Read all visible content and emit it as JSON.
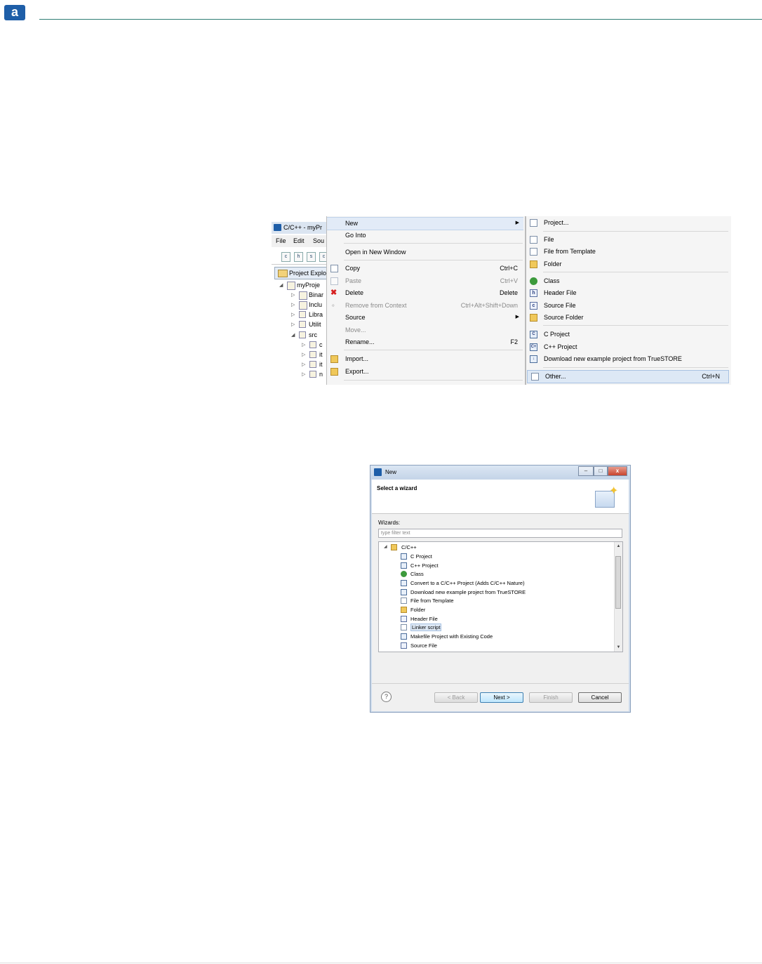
{
  "doc": {
    "logo_letter": "a"
  },
  "ide": {
    "title": "C/C++ - myPr",
    "menus": [
      "File",
      "Edit",
      "Sou"
    ],
    "toolbar": [
      "c",
      "h",
      "s",
      "c"
    ],
    "explorer_tab": "Project Explo",
    "tree": [
      {
        "arrow": "◢",
        "label": "myProje",
        "indent": 0
      },
      {
        "arrow": "▷",
        "label": "Binar",
        "indent": 1
      },
      {
        "arrow": "▷",
        "label": "Inclu",
        "indent": 1
      },
      {
        "arrow": "▷",
        "label": "Libra",
        "indent": 1
      },
      {
        "arrow": "▷",
        "label": "Utilit",
        "indent": 1
      },
      {
        "arrow": "◢",
        "label": "src",
        "indent": 1
      },
      {
        "arrow": "▷",
        "label": "c",
        "indent": 2
      },
      {
        "arrow": "▷",
        "label": "it",
        "indent": 2
      },
      {
        "arrow": "▷",
        "label": "it",
        "indent": 2
      },
      {
        "arrow": "▷",
        "label": "n",
        "indent": 2
      }
    ]
  },
  "context_menu": {
    "items": [
      {
        "label": "New",
        "shortcut": "",
        "submenu": true,
        "disabled": false,
        "highlight": true,
        "icon": ""
      },
      {
        "label": "Go Into",
        "shortcut": "",
        "submenu": false,
        "disabled": false,
        "icon": ""
      },
      {
        "label": "Open in New Window",
        "shortcut": "",
        "submenu": false,
        "disabled": false,
        "icon": ""
      },
      {
        "label": "Copy",
        "shortcut": "Ctrl+C",
        "submenu": false,
        "disabled": false,
        "icon": "copy-icon"
      },
      {
        "label": "Paste",
        "shortcut": "Ctrl+V",
        "submenu": false,
        "disabled": true,
        "icon": "paste-icon"
      },
      {
        "label": "Delete",
        "shortcut": "Delete",
        "submenu": false,
        "disabled": false,
        "icon": "delete-icon"
      },
      {
        "label": "Remove from Context",
        "shortcut": "Ctrl+Alt+Shift+Down",
        "submenu": false,
        "disabled": true,
        "icon": "remove-context-icon"
      },
      {
        "label": "Source",
        "shortcut": "",
        "submenu": true,
        "disabled": false,
        "icon": ""
      },
      {
        "label": "Move...",
        "shortcut": "",
        "submenu": false,
        "disabled": true,
        "icon": ""
      },
      {
        "label": "Rename...",
        "shortcut": "F2",
        "submenu": false,
        "disabled": false,
        "icon": ""
      },
      {
        "label": "Import...",
        "shortcut": "",
        "submenu": false,
        "disabled": false,
        "icon": "import-icon"
      },
      {
        "label": "Export...",
        "shortcut": "",
        "submenu": false,
        "disabled": false,
        "icon": "export-icon"
      }
    ]
  },
  "new_submenu": {
    "items": [
      {
        "label": "Project...",
        "shortcut": "",
        "icon": "project-icon"
      },
      {
        "label": "File",
        "shortcut": "",
        "icon": "file-icon"
      },
      {
        "label": "File from Template",
        "shortcut": "",
        "icon": "file-template-icon"
      },
      {
        "label": "Folder",
        "shortcut": "",
        "icon": "folder-icon"
      },
      {
        "label": "Class",
        "shortcut": "",
        "icon": "class-icon"
      },
      {
        "label": "Header File",
        "shortcut": "",
        "icon": "header-file-icon"
      },
      {
        "label": "Source File",
        "shortcut": "",
        "icon": "source-file-icon"
      },
      {
        "label": "Source Folder",
        "shortcut": "",
        "icon": "source-folder-icon"
      },
      {
        "label": "C Project",
        "shortcut": "",
        "icon": "c-project-icon"
      },
      {
        "label": "C++ Project",
        "shortcut": "",
        "icon": "cpp-project-icon"
      },
      {
        "label": "Download new example project from TrueSTORE",
        "shortcut": "",
        "icon": "download-icon"
      },
      {
        "label": "Other...",
        "shortcut": "Ctrl+N",
        "icon": "other-icon"
      }
    ]
  },
  "dialog": {
    "title": "New",
    "header": "Select a wizard",
    "wizards_label": "Wizards:",
    "filter_placeholder": "type filter text",
    "tree": [
      {
        "label": "C/C++",
        "icon": "folder-icon",
        "expander": "◢"
      },
      {
        "label": "C Project",
        "icon": "c-project-icon"
      },
      {
        "label": "C++ Project",
        "icon": "cpp-project-icon"
      },
      {
        "label": "Class",
        "icon": "class-icon"
      },
      {
        "label": "Convert to a C/C++ Project (Adds C/C++ Nature)",
        "icon": "convert-icon"
      },
      {
        "label": "Download new example project from TrueSTORE",
        "icon": "download-icon"
      },
      {
        "label": "File from Template",
        "icon": "file-template-icon"
      },
      {
        "label": "Folder",
        "icon": "folder-icon"
      },
      {
        "label": "Header File",
        "icon": "header-file-icon"
      },
      {
        "label": "Linker script",
        "icon": "linker-script-icon",
        "selected": true
      },
      {
        "label": "Makefile Project with Existing Code",
        "icon": "makefile-icon"
      },
      {
        "label": "Source File",
        "icon": "source-file-icon"
      }
    ],
    "buttons": {
      "back": "< Back",
      "next": "Next >",
      "finish": "Finish",
      "cancel": "Cancel",
      "help": "?"
    },
    "window_buttons": {
      "minimize": "–",
      "maximize": "□",
      "close": "x"
    }
  }
}
